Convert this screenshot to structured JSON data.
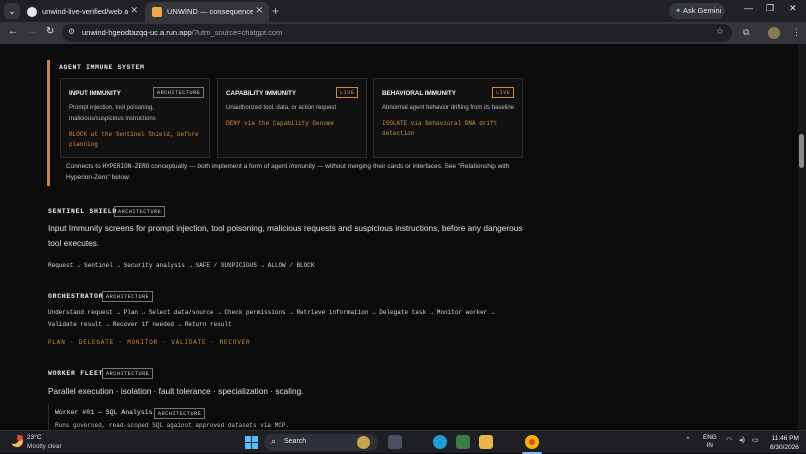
{
  "browser": {
    "tabs": [
      {
        "title": "unwind-live-verified/web at m..."
      },
      {
        "title": "UNWIND — consequence cle..."
      }
    ],
    "new_tab": "+",
    "ask_gemini": "Ask Gemini",
    "url_main": "unwind-hgeodtazqq-uc.a.run.app",
    "url_rest": "/?utm_source=chatgpt.com"
  },
  "immune": {
    "title": "AGENT IMMUNE SYSTEM",
    "cards": [
      {
        "title": "INPUT IMMUNITY",
        "badge": "ARCHITECTURE",
        "desc": "Prompt injection, tool poisoning, malicious/suspicious instructions",
        "action": "BLOCK at the Sentinel Shield, before planning"
      },
      {
        "title": "CAPABILITY IMMUNITY",
        "badge": "LIVE",
        "desc": "Unauthorized tool, data, or action request",
        "action": "DENY via the Capability Genome"
      },
      {
        "title": "BEHAVIORAL IMMUNITY",
        "badge": "LIVE",
        "desc": "Abnormal agent behavior drifting from its baseline",
        "action": "ISOLATE via Behavioral DNA drift detection"
      }
    ],
    "note_pre": "Connects to ",
    "note_code": "HYPERION-ZERO",
    "note_post": " conceptually — both implement a form of agent immunity — without merging their cards or interfaces. See \"Relationship with Hyperion-Zero\" below."
  },
  "sentinel": {
    "title": "SENTINEL SHIELD",
    "badge": "ARCHITECTURE",
    "lead": "Input Immunity screens for prompt injection, tool poisoning, malicious requests and suspicious instructions, before any dangerous tool executes.",
    "flow": "Request → Sentinel → Security analysis → SAFE / SUSPICIOUS → ALLOW / BLOCK"
  },
  "orchestrator": {
    "title": "ORCHESTRATOR",
    "badge": "ARCHITECTURE",
    "flow_line1": "Understand request → Plan → Select data/source → Check permissions → Retrieve information → Delegate task → Monitor worker →",
    "flow_line2": "Validate result → Recover if needed → Return result",
    "flow_orange": "PLAN · DELEGATE · MONITOR · VALIDATE · RECOVER"
  },
  "worker_fleet": {
    "title": "WORKER FLEET",
    "badge": "ARCHITECTURE",
    "lead": "Parallel execution · isolation · fault tolerance · specialization · scaling.",
    "worker_title": "Worker #01 — SQL Analysis",
    "worker_badge": "ARCHITECTURE",
    "worker_desc": "Runs governed, read-scoped SQL against approved datasets via MCP."
  },
  "taskbar": {
    "temp": "23°C",
    "weather": "Mostly clear",
    "search": "Search",
    "lang1": "ENG",
    "lang2": "IN",
    "time": "11:46 PM",
    "date": "8/30/2026",
    "badge_count": "1"
  },
  "colors": {
    "accent": "#d58a3a",
    "page_bg": "#0b0b0b",
    "card_border": "#2b2b2b"
  }
}
